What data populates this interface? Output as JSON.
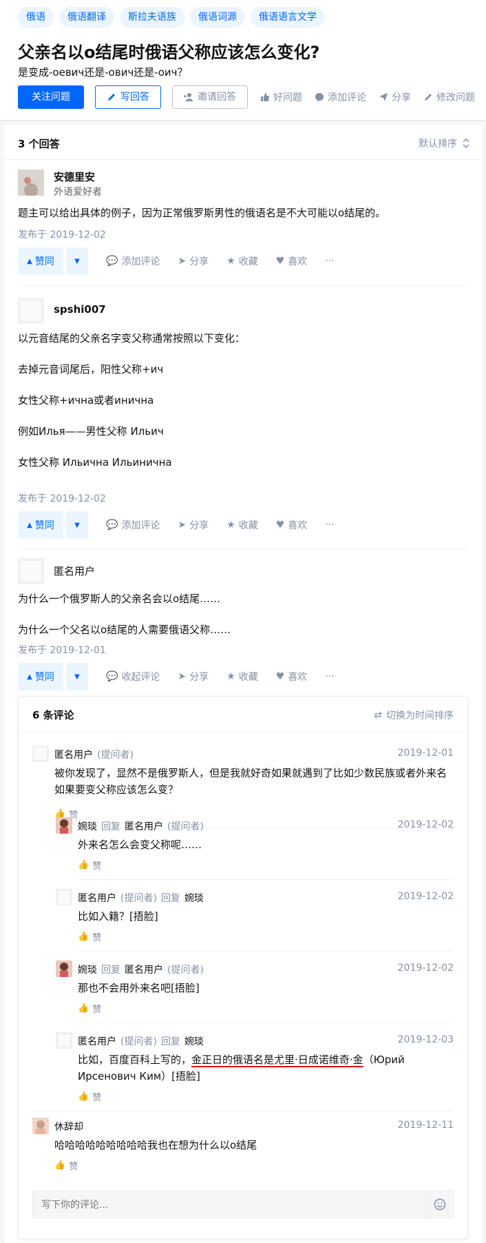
{
  "topics": [
    "俄语",
    "俄语翻译",
    "斯拉夫语族",
    "俄语词源",
    "俄语语言文学"
  ],
  "question": {
    "title": "父亲名以o结尾时俄语父称应该怎么变化?",
    "detail": "是变成-оевич还是-ович还是-оич？"
  },
  "actions": {
    "follow": "关注问题",
    "write": "写回答",
    "invite": "邀请回答",
    "good": "好问题",
    "comment": "添加评论",
    "share": "分享",
    "edit": "修改问题"
  },
  "list": {
    "count": "3 个回答",
    "sort": "默认排序"
  },
  "answers": [
    {
      "author": "安德里安",
      "bio": "外语爱好者",
      "lines": [
        "题主可以给出具体的例子，因为正常俄罗斯男性的俄语名是不大可能以o结尾的。"
      ],
      "date": "发布于 2019-12-02",
      "comment_label": "添加评论"
    },
    {
      "author": "spshi007",
      "lines": [
        "以元音结尾的父亲名字变父称通常按照以下变化：",
        "去掉元音词尾后，阳性父称+ич",
        "女性父称+ична或者инична",
        "例如Илья——男性父称 Ильич",
        "女性父称 Ильична Ильинична"
      ],
      "date": "发布于 2019-12-02",
      "comment_label": "添加评论"
    },
    {
      "author": "匿名用户",
      "lines": [
        "为什么一个俄罗斯人的父亲名会以o结尾……",
        "为什么一个父名以o结尾的人需要俄语父称……"
      ],
      "date": "发布于 2019-12-01",
      "comment_label": "收起评论"
    }
  ],
  "answer_actions": {
    "agree": "赞同",
    "share": "分享",
    "collect": "收藏",
    "like": "喜欢",
    "more": "···"
  },
  "comments": {
    "count": "6 条评论",
    "switch": "切换为时间排序",
    "like": "赞",
    "reply": "回复",
    "asker": "(提问者)",
    "items": [
      {
        "user": "匿名用户",
        "tag": "(提问者)",
        "date": "2019-12-01",
        "text1": "被你发现了，显然不是俄罗斯人，但是我就好奇如果就遇到了比如少数民族或者外来名",
        "text2": "如果要变父称应该怎么变？"
      },
      {
        "user": "婉琰",
        "reply_to": "匿名用户",
        "date": "2019-12-02",
        "text1": "外来名怎么会变父称呢……"
      },
      {
        "user": "匿名用户",
        "tag": "(提问者)",
        "reply_to": "婉琰",
        "date": "2019-12-02",
        "text1": "比如入籍？[捂脸]"
      },
      {
        "user": "婉琰",
        "reply_to": "匿名用户",
        "reply_tag": "(提问者)",
        "date": "2019-12-02",
        "text1": "那也不会用外来名吧[捂脸]"
      },
      {
        "user": "匿名用户",
        "tag": "(提问者)",
        "reply_to": "婉琰",
        "date": "2019-12-03",
        "text1_a": "比如，百度百科上写的，",
        "text1_b": "金正日的俄语名是尤里·日成诺维奇·金",
        "text1_c": "（Юрий",
        "text2": "Ирсенович Ким）[捂脸]"
      },
      {
        "user": "休辞却",
        "date": "2019-12-11",
        "text1": "哈哈哈哈哈哈哈哈哈我也在想为什么以o结尾"
      }
    ],
    "placeholder": "写下你的评论..."
  },
  "colors": {
    "brand": "#0066ff",
    "muted": "#8590a6",
    "underline": "#ee1111"
  }
}
